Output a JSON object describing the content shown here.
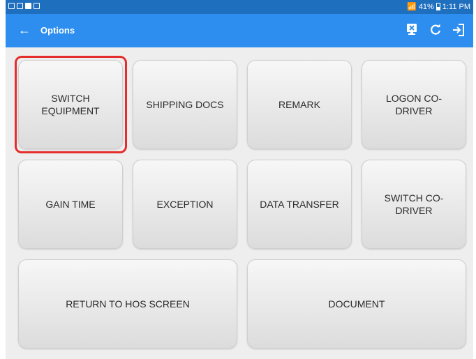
{
  "status_bar": {
    "battery": "41%",
    "time": "1:11 PM"
  },
  "app_bar": {
    "back_glyph": "←",
    "title": "Options",
    "actions": [
      "screen-icon",
      "refresh-icon",
      "logout-icon"
    ]
  },
  "buttons": {
    "switch_equipment": "SWITCH EQUIPMENT",
    "shipping_docs": "SHIPPING DOCS",
    "remark": "REMARK",
    "logon_co_driver": "LOGON CO-DRIVER",
    "gain_time": "GAIN TIME",
    "exception": "EXCEPTION",
    "data_transfer": "DATA TRANSFER",
    "switch_co_driver": "SWITCH CO-DRIVER",
    "return_to_hos": "RETURN TO HOS SCREEN",
    "document": "DOCUMENT"
  },
  "colors": {
    "status_bar": "#1f6fbf",
    "app_bar": "#2d8ef0",
    "highlight": "#e52d2d"
  }
}
